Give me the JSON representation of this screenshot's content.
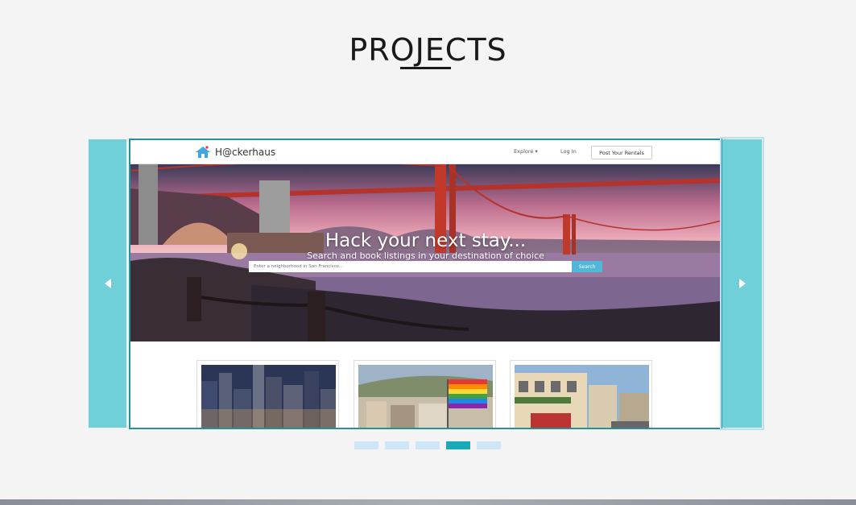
{
  "section": {
    "title": "PROJECTS"
  },
  "carousel": {
    "prev_icon": "chevron-left-icon",
    "next_icon": "chevron-right-icon",
    "accent_color": "#6fd0da",
    "indicators": [
      {
        "active": false
      },
      {
        "active": false
      },
      {
        "active": false
      },
      {
        "active": true
      },
      {
        "active": false
      }
    ]
  },
  "slide": {
    "logo_text": "H@ckerhaus",
    "logo_icon": "house-icon",
    "nav": {
      "explore": "Explore ▾",
      "login": "Log In",
      "post": "Post Your Rentals"
    },
    "hero": {
      "title": "Hack your next stay...",
      "subtitle": "Search and book listings in your destination of choice",
      "search_placeholder": "Enter a neighborhood in San Francisco...",
      "search_button": "Search"
    },
    "cards": [
      {
        "image": "city-skyline-night"
      },
      {
        "image": "castro-rainbow-flag"
      },
      {
        "image": "victorian-street-cablecar"
      }
    ]
  }
}
